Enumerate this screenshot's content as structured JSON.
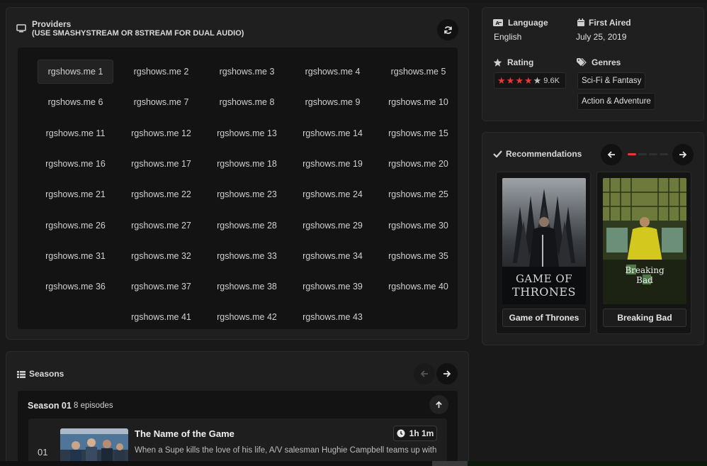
{
  "providers": {
    "title": "Providers",
    "subtitle": "(USE SMASHYSTREAM OR 8STREAM FOR DUAL AUDIO)",
    "items": [
      "rgshows.me 1",
      "rgshows.me 2",
      "rgshows.me 3",
      "rgshows.me 4",
      "rgshows.me 5",
      "rgshows.me 6",
      "rgshows.me 7",
      "rgshows.me 8",
      "rgshows.me 9",
      "rgshows.me 10",
      "rgshows.me 11",
      "rgshows.me 12",
      "rgshows.me 13",
      "rgshows.me 14",
      "rgshows.me 15",
      "rgshows.me 16",
      "rgshows.me 17",
      "rgshows.me 18",
      "rgshows.me 19",
      "rgshows.me 20",
      "rgshows.me 21",
      "rgshows.me 22",
      "rgshows.me 23",
      "rgshows.me 24",
      "rgshows.me 25",
      "rgshows.me 26",
      "rgshows.me 27",
      "rgshows.me 28",
      "rgshows.me 29",
      "rgshows.me 30",
      "rgshows.me 31",
      "rgshows.me 32",
      "rgshows.me 33",
      "rgshows.me 34",
      "rgshows.me 35",
      "rgshows.me 36",
      "rgshows.me 37",
      "rgshows.me 38",
      "rgshows.me 39",
      "rgshows.me 40",
      "rgshows.me 41",
      "rgshows.me 42",
      "rgshows.me 43"
    ],
    "active_index": 0
  },
  "seasons": {
    "title": "Seasons",
    "season_name": "Season 01",
    "episode_count": "8 episodes",
    "episode": {
      "number": "01",
      "title": "The Name of the Game",
      "duration": "1h 1m",
      "description": "When a Supe kills the love of his life, A/V salesman Hughie Campbell teams up with"
    }
  },
  "info": {
    "language_label": "Language",
    "language_value": "English",
    "first_aired_label": "First Aired",
    "first_aired_value": "July 25, 2019",
    "rating_label": "Rating",
    "rating_stars": 4,
    "rating_count": "9.6K",
    "genres_label": "Genres",
    "genres": [
      "Sci-Fi & Fantasy",
      "Action & Adventure"
    ]
  },
  "recommendations": {
    "title": "Recommendations",
    "items": [
      {
        "name": "Game of Thrones",
        "poster_text": [
          "GAME OF",
          "THRONES"
        ]
      },
      {
        "name": "Breaking Bad",
        "poster_text": [
          "Breaking",
          "Bad"
        ]
      }
    ]
  },
  "colors": {
    "accent": "#e53a3a",
    "panel": "#1f1f1f",
    "background": "#191919"
  }
}
